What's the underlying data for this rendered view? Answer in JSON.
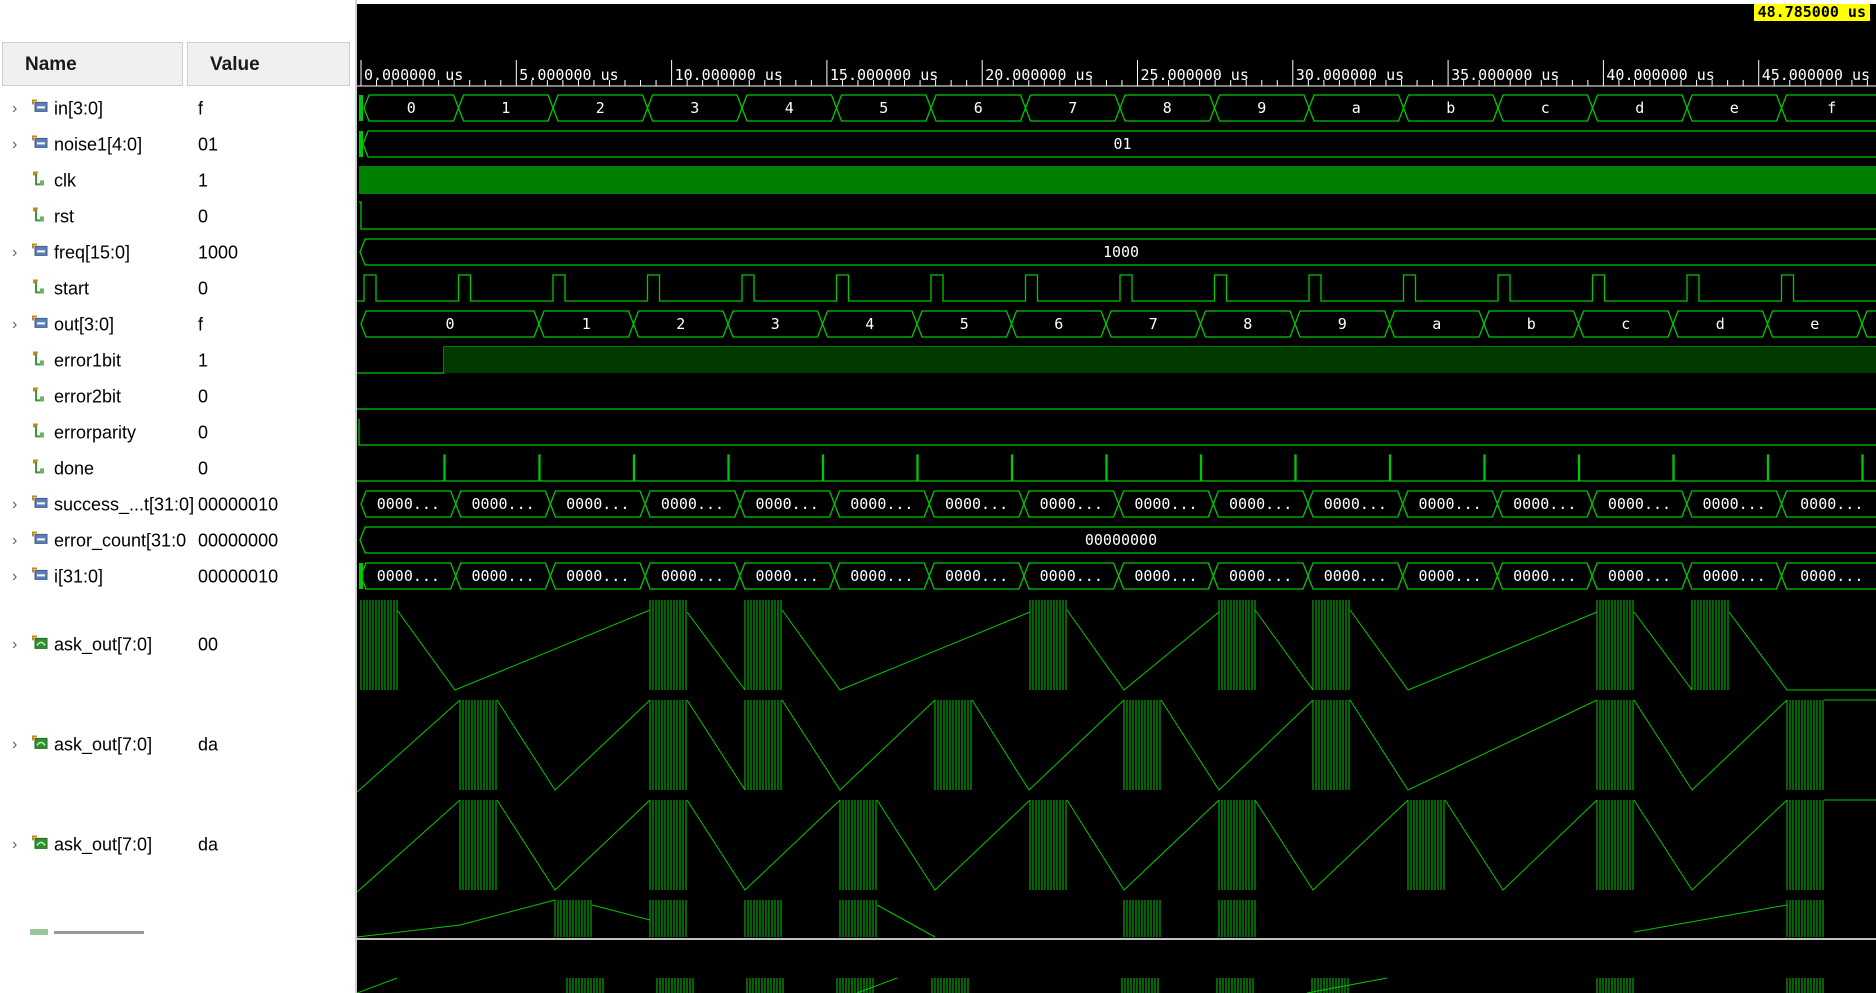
{
  "header": {
    "name_label": "Name",
    "value_label": "Value"
  },
  "cursor": {
    "time": "48.785000 us"
  },
  "timeline": {
    "ticks": [
      "0.000000 us",
      "5.000000 us",
      "10.000000 us",
      "15.000000 us",
      "20.000000 us",
      "25.000000 us",
      "30.000000 us",
      "35.000000 us",
      "40.000000 us",
      "45.000000 us"
    ]
  },
  "signals": [
    {
      "name": "in[3:0]",
      "value": "f",
      "expandable": true,
      "icon": "bus-icon"
    },
    {
      "name": "noise1[4:0]",
      "value": "01",
      "expandable": true,
      "icon": "bus-icon"
    },
    {
      "name": "clk",
      "value": "1",
      "expandable": false,
      "icon": "wire-icon"
    },
    {
      "name": "rst",
      "value": "0",
      "expandable": false,
      "icon": "wire-icon"
    },
    {
      "name": "freq[15:0]",
      "value": "1000",
      "expandable": true,
      "icon": "bus-icon"
    },
    {
      "name": "start",
      "value": "0",
      "expandable": false,
      "icon": "wire-icon"
    },
    {
      "name": "out[3:0]",
      "value": "f",
      "expandable": true,
      "icon": "bus-icon"
    },
    {
      "name": "error1bit",
      "value": "1",
      "expandable": false,
      "icon": "wire-icon"
    },
    {
      "name": "error2bit",
      "value": "0",
      "expandable": false,
      "icon": "wire-icon"
    },
    {
      "name": "errorparity",
      "value": "0",
      "expandable": false,
      "icon": "wire-icon"
    },
    {
      "name": "done",
      "value": "0",
      "expandable": false,
      "icon": "wire-icon"
    },
    {
      "name": "success_...t[31:0]",
      "value": "00000010",
      "expandable": true,
      "icon": "bus-icon"
    },
    {
      "name": "error_count[31:0",
      "value": "00000000",
      "expandable": true,
      "icon": "bus-icon"
    },
    {
      "name": "i[31:0]",
      "value": "00000010",
      "expandable": true,
      "icon": "bus-icon"
    },
    {
      "name": "ask_out[7:0]",
      "value": "00",
      "expandable": true,
      "icon": "analog-icon"
    },
    {
      "name": "ask_out[7:0]",
      "value": "da",
      "expandable": true,
      "icon": "analog-icon"
    },
    {
      "name": "ask_out[7:0]",
      "value": "da",
      "expandable": true,
      "icon": "analog-icon"
    }
  ],
  "waves": {
    "in_values": [
      "0",
      "1",
      "2",
      "3",
      "4",
      "5",
      "6",
      "7",
      "8",
      "9",
      "a",
      "b",
      "c",
      "d",
      "e",
      "f"
    ],
    "noise1_value": "01",
    "freq_value": "1000",
    "out_values": [
      "0",
      "1",
      "2",
      "3",
      "4",
      "5",
      "6",
      "7",
      "8",
      "9",
      "a",
      "b",
      "c",
      "d",
      "e"
    ],
    "success_values": [
      "0000...",
      "0000...",
      "0000...",
      "0000...",
      "0000...",
      "0000...",
      "0000...",
      "0000...",
      "0000...",
      "0000...",
      "0000...",
      "0000...",
      "0000...",
      "0000...",
      "0000...",
      "0000..."
    ],
    "error_count_value": "00000000",
    "i_values": [
      "0000...",
      "0000...",
      "0000...",
      "0000...",
      "0000...",
      "0000...",
      "0000...",
      "0000...",
      "0000...",
      "0000...",
      "0000...",
      "0000...",
      "0000...",
      "0000...",
      "0000...",
      "0000..."
    ]
  },
  "colors": {
    "wave": "#00c800",
    "text": "#ffffff",
    "background": "#000000",
    "cursor_bg": "#ffff00"
  }
}
